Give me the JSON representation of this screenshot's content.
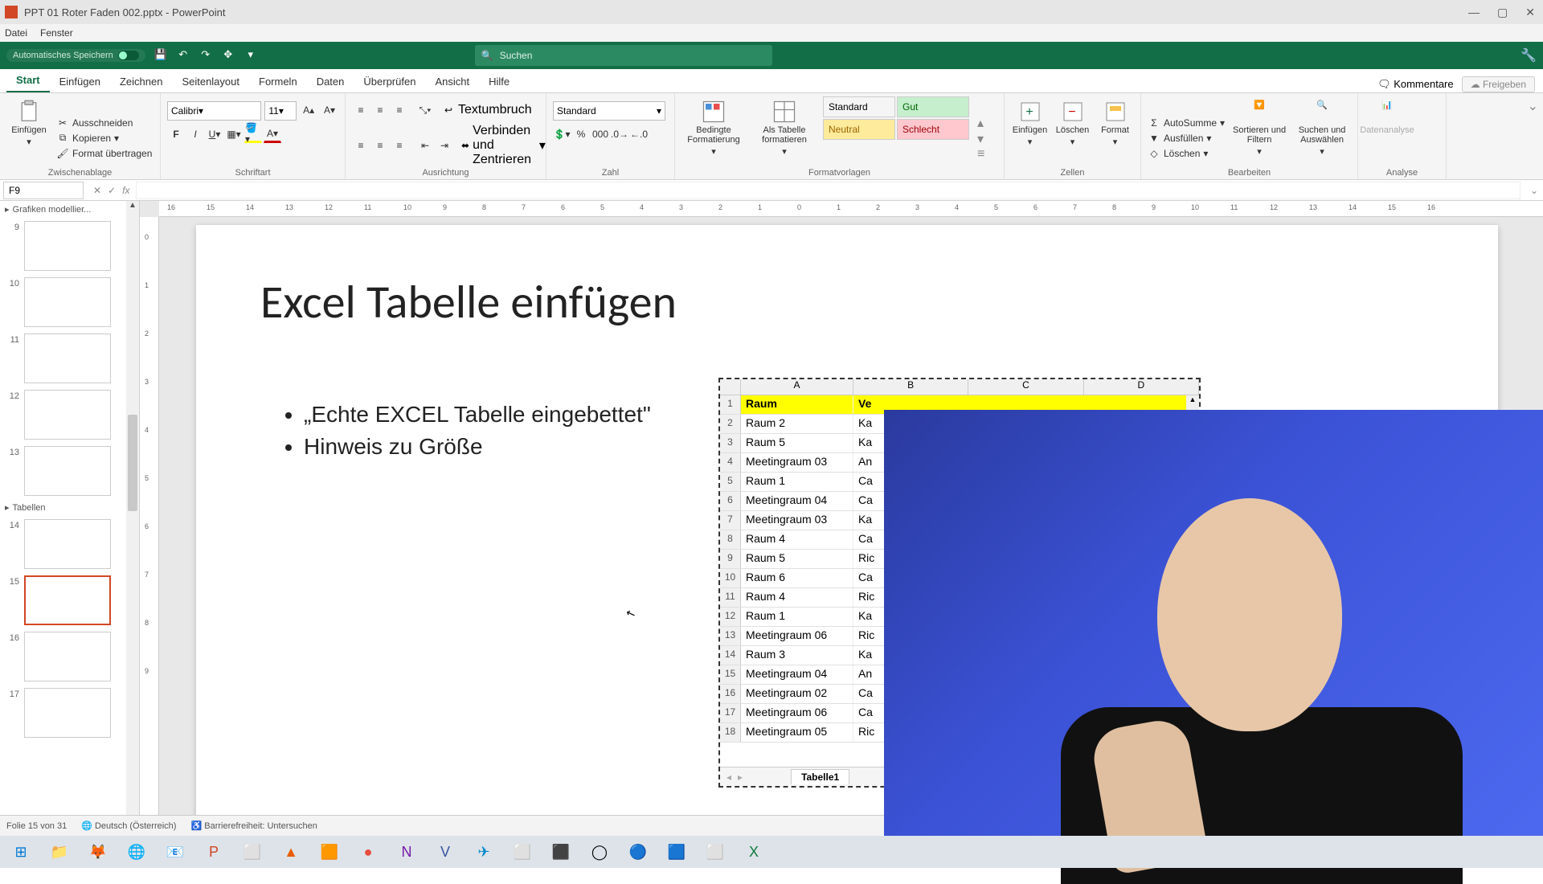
{
  "window": {
    "title": "PPT 01 Roter Faden 002.pptx - PowerPoint"
  },
  "menubar": {
    "file": "Datei",
    "window": "Fenster"
  },
  "qat": {
    "autosave": "Automatisches Speichern",
    "search_placeholder": "Suchen"
  },
  "tabs": {
    "start": "Start",
    "einfuegen": "Einfügen",
    "zeichnen": "Zeichnen",
    "seitenlayout": "Seitenlayout",
    "formeln": "Formeln",
    "daten": "Daten",
    "ueberpruefen": "Überprüfen",
    "ansicht": "Ansicht",
    "hilfe": "Hilfe",
    "kommentare": "Kommentare",
    "freigeben": "Freigeben"
  },
  "ribbon": {
    "clipboard": {
      "paste": "Einfügen",
      "cut": "Ausschneiden",
      "copy": "Kopieren",
      "format_painter": "Format übertragen",
      "label": "Zwischenablage"
    },
    "font": {
      "name": "Calibri",
      "size": "11",
      "label": "Schriftart"
    },
    "align": {
      "wrap": "Textumbruch",
      "merge": "Verbinden und Zentrieren",
      "label": "Ausrichtung"
    },
    "number": {
      "format": "Standard",
      "label": "Zahl"
    },
    "styles": {
      "cond": "Bedingte Formatierung",
      "table": "Als Tabelle formatieren",
      "standard": "Standard",
      "gut": "Gut",
      "neutral": "Neutral",
      "schlecht": "Schlecht",
      "label": "Formatvorlagen"
    },
    "cells": {
      "insert": "Einfügen",
      "delete": "Löschen",
      "format": "Format",
      "label": "Zellen"
    },
    "editing": {
      "autosum": "AutoSumme",
      "fill": "Ausfüllen",
      "clear": "Löschen",
      "sort": "Sortieren und Filtern",
      "find": "Suchen und Auswählen",
      "label": "Bearbeiten"
    },
    "analysis": {
      "data": "Datenanalyse",
      "label": "Analyse"
    }
  },
  "namebox": "F9",
  "thumbs": {
    "section1": "Grafiken modellier...",
    "section2": "Tabellen",
    "nums": [
      "9",
      "10",
      "11",
      "12",
      "13",
      "14",
      "15",
      "16",
      "17"
    ]
  },
  "slide": {
    "title": "Excel Tabelle einfügen",
    "bullet1": "„Echte EXCEL Tabelle eingebettet\"",
    "bullet2": "Hinweis zu Größe"
  },
  "excel": {
    "cols": [
      "A",
      "B",
      "C",
      "D"
    ],
    "header": {
      "a": "Raum",
      "b": "Ve"
    },
    "rows": [
      {
        "n": "2",
        "a": "Raum 2",
        "b": "Ka"
      },
      {
        "n": "3",
        "a": "Raum 5",
        "b": "Ka"
      },
      {
        "n": "4",
        "a": "Meetingraum 03",
        "b": "An"
      },
      {
        "n": "5",
        "a": "Raum 1",
        "b": "Ca"
      },
      {
        "n": "6",
        "a": "Meetingraum 04",
        "b": "Ca"
      },
      {
        "n": "7",
        "a": "Meetingraum 03",
        "b": "Ka"
      },
      {
        "n": "8",
        "a": "Raum 4",
        "b": "Ca"
      },
      {
        "n": "9",
        "a": "Raum 5",
        "b": "Ric"
      },
      {
        "n": "10",
        "a": "Raum 6",
        "b": "Ca"
      },
      {
        "n": "11",
        "a": "Raum 4",
        "b": "Ric"
      },
      {
        "n": "12",
        "a": "Raum 1",
        "b": "Ka"
      },
      {
        "n": "13",
        "a": "Meetingraum 06",
        "b": "Ric"
      },
      {
        "n": "14",
        "a": "Raum 3",
        "b": "Ka"
      },
      {
        "n": "15",
        "a": "Meetingraum 04",
        "b": "An"
      },
      {
        "n": "16",
        "a": "Meetingraum 02",
        "b": "Ca"
      },
      {
        "n": "17",
        "a": "Meetingraum 06",
        "b": "Ca"
      },
      {
        "n": "18",
        "a": "Meetingraum 05",
        "b": "Ric"
      }
    ],
    "sheet": "Tabelle1"
  },
  "status": {
    "slide": "Folie 15 von 31",
    "lang": "Deutsch (Österreich)",
    "access": "Barrierefreiheit: Untersuchen"
  },
  "ruler_h": [
    "16",
    "15",
    "14",
    "13",
    "12",
    "11",
    "10",
    "9",
    "8",
    "7",
    "6",
    "5",
    "4",
    "3",
    "2",
    "1",
    "0",
    "1",
    "2",
    "3",
    "4",
    "5",
    "6",
    "7",
    "8",
    "9",
    "10",
    "11",
    "12",
    "13",
    "14",
    "15",
    "16"
  ],
  "ruler_v": [
    "0",
    "1",
    "2",
    "3",
    "4",
    "5",
    "6",
    "7",
    "8",
    "9"
  ]
}
